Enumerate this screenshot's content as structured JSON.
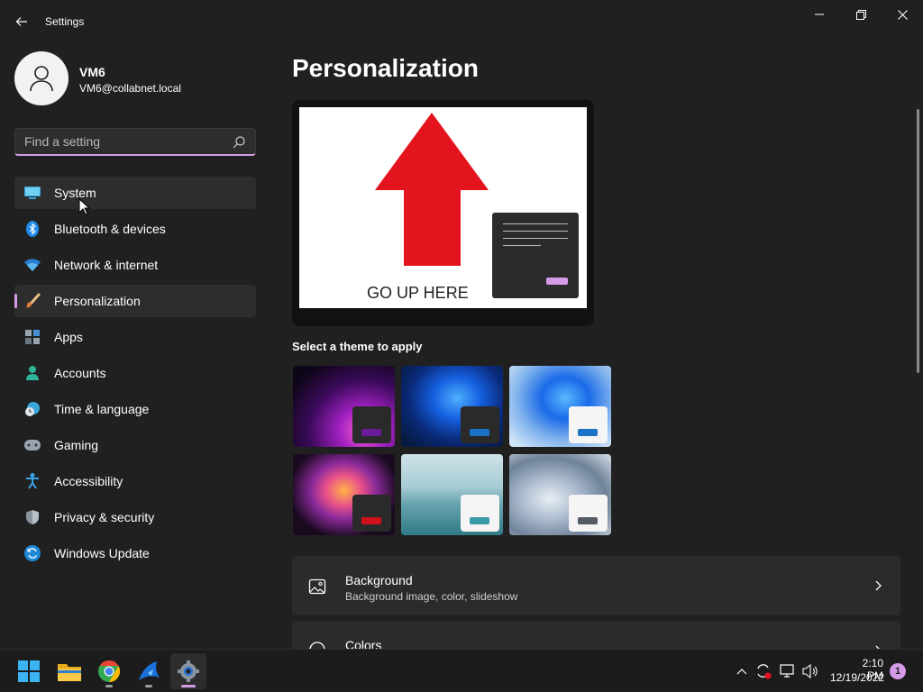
{
  "window": {
    "title": "Settings"
  },
  "profile": {
    "name": "VM6",
    "email": "VM6@collabnet.local"
  },
  "search": {
    "placeholder": "Find a setting"
  },
  "sidebar": {
    "items": [
      {
        "label": "System",
        "icon": "monitor-icon"
      },
      {
        "label": "Bluetooth & devices",
        "icon": "bluetooth-icon"
      },
      {
        "label": "Network & internet",
        "icon": "wifi-icon"
      },
      {
        "label": "Personalization",
        "icon": "brush-icon"
      },
      {
        "label": "Apps",
        "icon": "apps-icon"
      },
      {
        "label": "Accounts",
        "icon": "person-icon"
      },
      {
        "label": "Time & language",
        "icon": "clock-globe-icon"
      },
      {
        "label": "Gaming",
        "icon": "controller-icon"
      },
      {
        "label": "Accessibility",
        "icon": "accessibility-icon"
      },
      {
        "label": "Privacy & security",
        "icon": "shield-icon"
      },
      {
        "label": "Windows Update",
        "icon": "refresh-icon"
      }
    ],
    "selected": "Personalization",
    "hovered": "System"
  },
  "main": {
    "title": "Personalization",
    "preview_caption": "GO UP HERE",
    "theme_section_label": "Select a theme to apply",
    "themes": [
      {
        "name": "glow-purple",
        "accent": "#6a1b9a"
      },
      {
        "name": "bloom-dark",
        "accent": "#1a73c7"
      },
      {
        "name": "bloom-light",
        "accent": "#1a73c7"
      },
      {
        "name": "captured-motion",
        "accent": "#d0101a"
      },
      {
        "name": "sunrise-lake",
        "accent": "#3a9aa8"
      },
      {
        "name": "flow-grey",
        "accent": "#555b62"
      }
    ],
    "rows": [
      {
        "title": "Background",
        "subtitle": "Background image, color, slideshow",
        "icon": "image-icon"
      },
      {
        "title": "Colors",
        "subtitle": "",
        "icon": "palette-icon"
      }
    ]
  },
  "taskbar": {
    "apps": [
      "start-icon",
      "file-explorer-icon",
      "chrome-icon",
      "shark-app-icon",
      "settings-icon"
    ],
    "active_app": "settings-icon",
    "clock_time": "2:10 PM",
    "clock_date": "12/19/2022",
    "notification_count": "1"
  },
  "colors": {
    "accent": "#d59be6",
    "background": "#202020",
    "card": "#2b2b2b"
  }
}
